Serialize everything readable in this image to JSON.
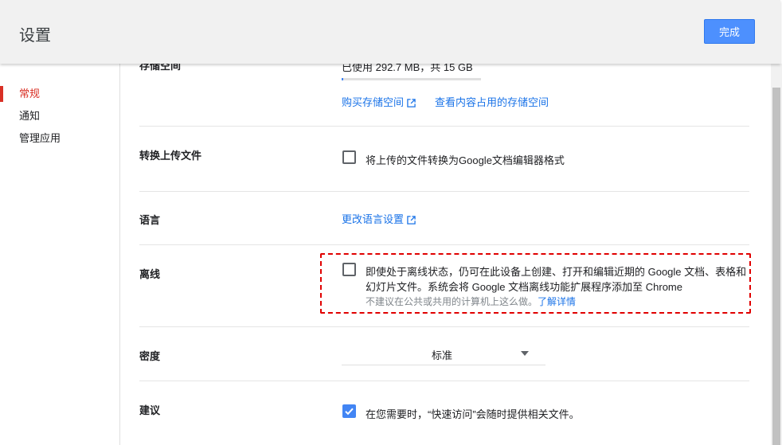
{
  "header": {
    "title": "设置",
    "done_label": "完成"
  },
  "sidebar": {
    "items": [
      {
        "label": "常规",
        "active": true
      },
      {
        "label": "通知",
        "active": false
      },
      {
        "label": "管理应用",
        "active": false
      }
    ]
  },
  "storage": {
    "label": "存储空间",
    "usage_text": "已使用 292.7 MB，共 15 GB",
    "buy_link": "购买存储空间",
    "view_link": "查看内容占用的存储空间"
  },
  "convert": {
    "label": "转换上传文件",
    "checkbox_text": "将上传的文件转换为Google文档编辑器格式",
    "checked": false
  },
  "language": {
    "label": "语言",
    "link": "更改语言设置"
  },
  "offline": {
    "label": "离线",
    "line1": "即使处于离线状态，仍可在此设备上创建、打开和编辑近期的 Google 文档、表格和",
    "line2": "幻灯片文件。系统会将 Google 文档离线功能扩展程序添加至 Chrome",
    "note": "不建议在公共或共用的计算机上这么做。",
    "learn_more": "了解详情",
    "checked": false
  },
  "density": {
    "label": "密度",
    "value": "标准"
  },
  "suggestions": {
    "label": "建议",
    "checkbox_text": "在您需要时，“快速访问”会随时提供相关文件。",
    "checked": true
  },
  "colors": {
    "accent": "#4d90fe",
    "link": "#1a73e8",
    "active_nav": "#d93025",
    "highlight_border": "#e00000"
  }
}
